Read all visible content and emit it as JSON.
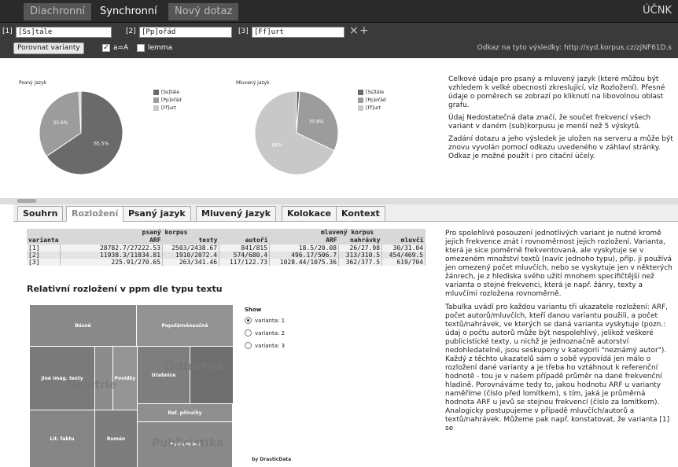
{
  "topbar": {
    "tabs": [
      "Diachronní",
      "Synchronní",
      "Nový dotaz"
    ],
    "brand": "ÚČNK"
  },
  "query": {
    "items": [
      {
        "label": "[1]",
        "value": "[Ss]tále"
      },
      {
        "label": "[2]",
        "value": "[Pp]ořád"
      },
      {
        "label": "[3]",
        "value": "[Ff]urt"
      }
    ],
    "remove_icon": "×",
    "add_icon": "+",
    "compare_button": "Porovnat varianty",
    "case_label": "a=A",
    "case_checked": true,
    "lemma_label": "lemma",
    "lemma_checked": false,
    "link_text": "Odkaz na tyto výsledky: http://syd.korpus.cz/zjNF61D.s"
  },
  "overview": {
    "pie_written": {
      "title": "Psaný jazyk",
      "labels": [
        "[Ss]tále",
        "[Pp]ořád",
        "[Ff]urt"
      ],
      "values": [
        65.5,
        33.6,
        0.9
      ],
      "value_labels": [
        "65.5%",
        "33.6%",
        ""
      ],
      "colors": [
        "#6a6a6a",
        "#9c9c9c",
        "#c8c8c8"
      ]
    },
    "pie_spoken": {
      "title": "Mluvený jazyk",
      "labels": [
        "[Ss]tále",
        "[Pp]ořád",
        "[Ff]urt"
      ],
      "values": [
        1.2,
        30.8,
        68.0
      ],
      "value_labels": [
        "",
        "30.8%",
        "68%"
      ],
      "colors": [
        "#6a6a6a",
        "#9c9c9c",
        "#c8c8c8"
      ]
    },
    "note_paragraphs": [
      "Celkové údaje pro psaný a mluvený jazyk (které můžou být vzhledem k velké obecnosti zkreslující, viz Rozložení). Přesné údaje o poměrech se zobrazí po kliknutí na libovolnou oblast grafu.",
      "Údaj Nedostatečná data značí, že součet frekvencí všech variant v daném (sub)korpusu je menší než 5 výskytů.",
      "Zadání dotazu a jeho výsledek je uložen na serveru a může být znovu vyvolán pomocí odkazu uvedeného v záhlaví stránky. Odkaz je možné použít i pro citační účely."
    ]
  },
  "tabs": [
    "Souhrn",
    "Rozložení",
    "Psaný jazyk",
    "Mluvený jazyk",
    "Kolokace",
    "Kontext"
  ],
  "active_tab": "Rozložení",
  "table": {
    "group_headers": [
      "psaný korpus",
      "mluvený korpus"
    ],
    "columns": [
      "varianta",
      "ARF",
      "texty",
      "autoři",
      "ARF",
      "nahrávky",
      "mluvči"
    ],
    "rows": [
      [
        "[1]",
        "28782.7/27222.53",
        "2503/2438.67",
        "841/815",
        "18.5/20.08",
        "26/27.98",
        "30/31.04"
      ],
      [
        "[2]",
        "11938.3/11834.81",
        "1910/2072.4",
        "574/680.4",
        "496.17/506.7",
        "313/310.5",
        "454/469.5"
      ],
      [
        "[3]",
        "225.91/270.65",
        "263/341.46",
        "117/122.73",
        "1028.44/1075.36",
        "362/377.5",
        "619/704"
      ]
    ]
  },
  "treemap": {
    "title": "Relativní rozložení v ppm dle typu textu",
    "labels": [
      "Básně",
      "Populárněnaučná",
      "Jiné imag. texty",
      "Povídky",
      "Učebnice",
      "Ref. příručky",
      "Lit. faktu",
      "Román",
      "Publicistika"
    ],
    "big_labels": [
      "Beletrie",
      "Odborná",
      "Publicistika"
    ],
    "show_label": "Show",
    "options": [
      "varianta: 1",
      "varianta: 2",
      "varianta: 3"
    ],
    "selected": 0,
    "credit": "by DrasticData"
  },
  "explanation": [
    "Pro spolehlivé posouzení jednotlivých variant je nutné kromě jejich frekvence znát i rovnoměrnost jejich rozložení. Varianta, která je sice poměrně frekventovaná, ale vyskytuje se v omezeném množství textů (navíc jednoho typu), příp. ji používá jen omezený počet mluvčích, nebo se vyskytuje jen v některých žánrech, je z hlediska svého užití mnohem specifičtější než varianta o stejné frekvenci, která je např. žánry, texty a mluvčími rozložena rovnoměrně.",
    "Tabulka uvádí pro každou variantu tři ukazatele rozložení: ARF, počet autorů/mluvčích, kteří danou variantu použili, a počet textů/nahrávek, ve kterých se daná varianta vyskytuje (pozn.: údaj o počtu autorů může být nespolehlivý, jelikož veškeré publicistické texty, u nichž je jednoznačně autorství nedohledatelné, jsou seskupeny v kategorii \"neznámý autor\"). Každý z těchto ukazatelů sám o sobě vypovídá jen málo o rozložení dané varianty a je třeba ho vztáhnout k referenční hodnotě - tou je v našem případě průměr na dané frekvenční hladině. Porovnáváme tedy to, jakou hodnotu ARF u varianty naměříme (číslo před lomítkem), s tím, jaká je průměrná hodnota ARF u jevů se stejnou frekvencí (číslo za lomítkem). Analogicky postupujeme v případě mluvčích/autorů a textů/nahrávek. Můžeme pak např. konstatovat, že varianta [1] se"
  ]
}
